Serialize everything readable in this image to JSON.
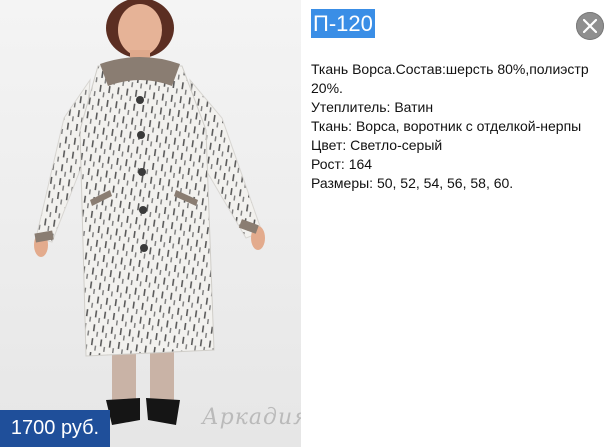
{
  "product": {
    "title": "П-120",
    "price": "1700 руб.",
    "watermark": "Аркадия",
    "description": [
      "Ткань Ворса.Состав:шерсть 80%,полиэстр 20%.",
      "Утеплитель: Ватин",
      "Ткань: Ворса, воротник с отделкой-нерпы",
      "Цвет: Светло-серый",
      "Рост: 164",
      "Размеры: 50, 52, 54, 56, 58, 60."
    ]
  },
  "controls": {
    "close_icon": "close-icon"
  },
  "colors": {
    "title_highlight": "#3a8ee6",
    "price_badge": "#1f4f9a",
    "close_button": "#8f8f8f"
  }
}
